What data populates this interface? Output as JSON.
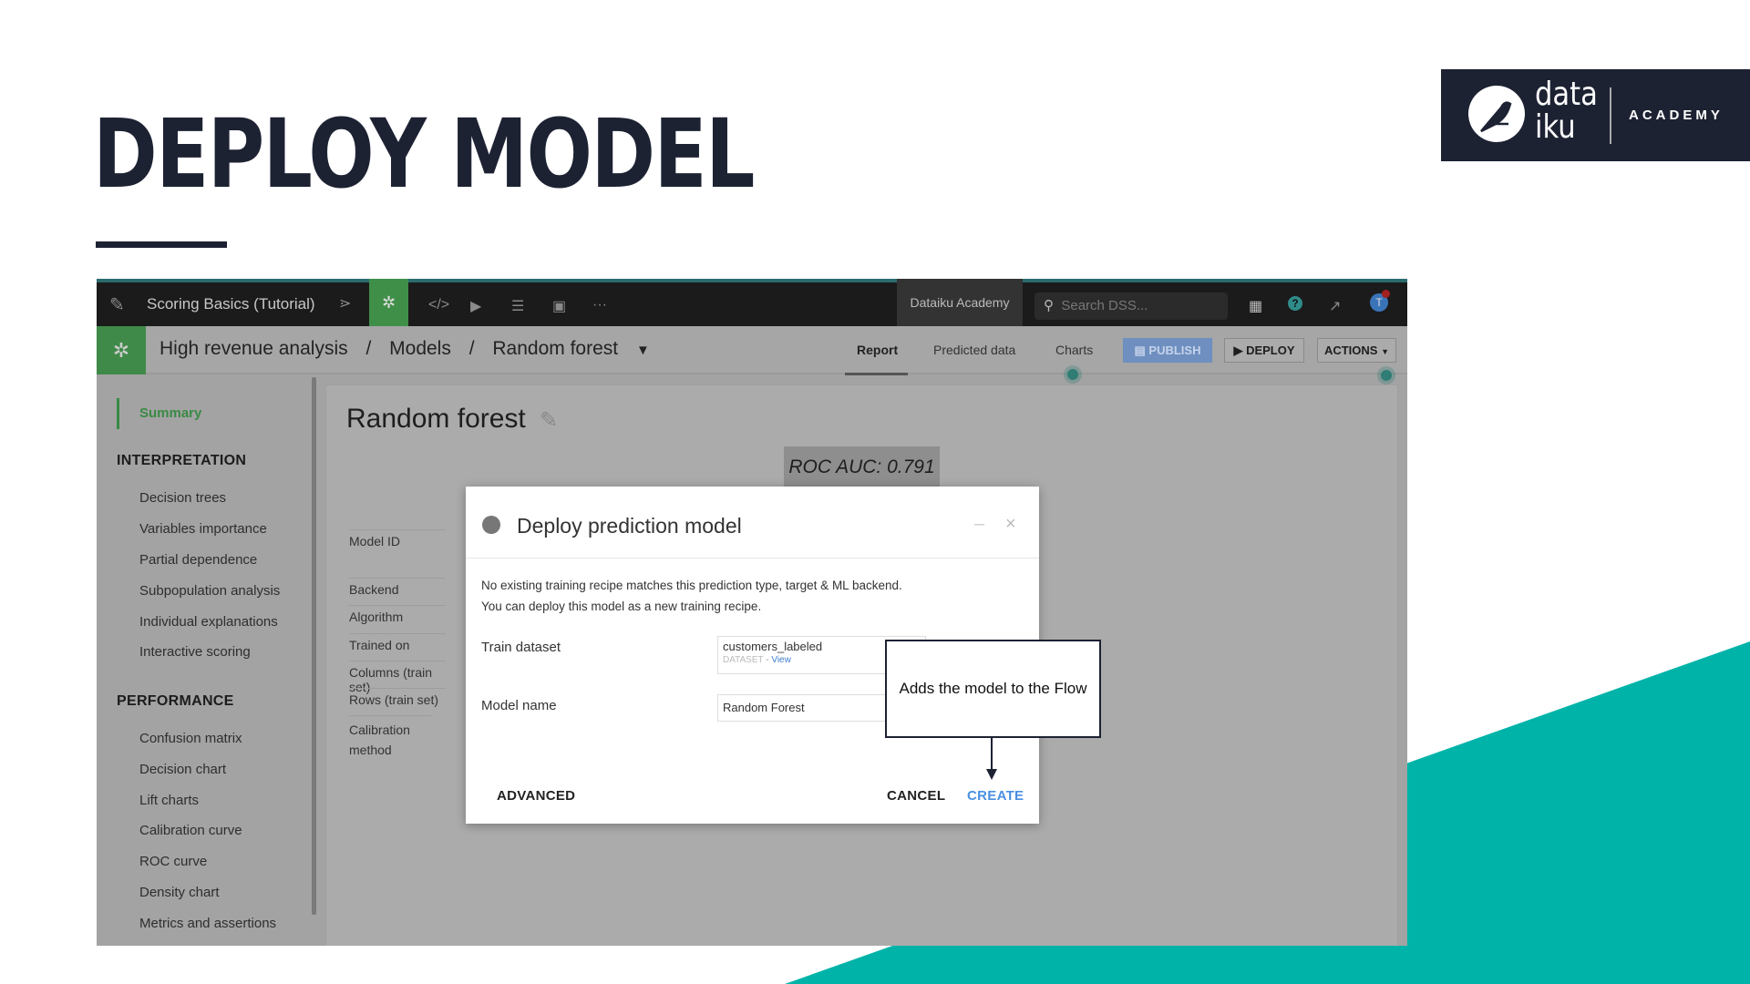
{
  "slide": {
    "title": "DEPLOY MODEL",
    "logo": {
      "word1": "data",
      "word2": "iku",
      "tagline": "ACADEMY"
    },
    "accent": "#00b3a8",
    "dark": "#1d2233"
  },
  "topbar": {
    "project": "Scoring Basics (Tutorial)",
    "instance": "Dataiku Academy",
    "search_placeholder": "Search DSS...",
    "avatar": "T",
    "icons": [
      "dataiku-bird-icon",
      "flow-icon",
      "ml-icon",
      "code-icon",
      "run-icon",
      "deploy-stack-icon",
      "dashboard-icon",
      "more-icon",
      "apps-grid-icon",
      "help-icon",
      "trend-icon",
      "avatar-icon"
    ]
  },
  "breadcrumb": {
    "items": [
      "High revenue analysis",
      "Models",
      "Random forest"
    ],
    "sep": "/"
  },
  "tabs": [
    {
      "label": "Report",
      "active": true
    },
    {
      "label": "Predicted data"
    },
    {
      "label": "Charts"
    }
  ],
  "actions": {
    "publish": "PUBLISH",
    "deploy": "DEPLOY",
    "actions": "ACTIONS"
  },
  "sidebar": {
    "summary": "Summary",
    "sections": [
      {
        "title": "INTERPRETATION",
        "items": [
          "Decision trees",
          "Variables importance",
          "Partial dependence",
          "Subpopulation analysis",
          "Individual explanations",
          "Interactive scoring"
        ]
      },
      {
        "title": "PERFORMANCE",
        "items": [
          "Confusion matrix",
          "Decision chart",
          "Lift charts",
          "Calibration curve",
          "ROC curve",
          "Density chart",
          "Metrics and assertions"
        ]
      }
    ]
  },
  "main": {
    "title": "Random forest",
    "roc": "ROC AUC: 0.791",
    "labels": [
      "Model ID",
      "Backend",
      "Algorithm",
      "Trained on",
      "Columns (train set)",
      "Rows (train set)",
      "Calibration method"
    ]
  },
  "dialog": {
    "title": "Deploy prediction model",
    "line1": "No existing training recipe matches this prediction type, target & ML backend.",
    "line2": "You can deploy this model as a new training recipe.",
    "train_label": "Train dataset",
    "train_value": "customers_labeled",
    "train_type": "DATASET",
    "train_sep": " - ",
    "train_link": "View",
    "name_label": "Model name",
    "name_value": "Random Forest",
    "advanced": "ADVANCED",
    "cancel": "CANCEL",
    "create": "CREATE"
  },
  "callout": {
    "text": "Adds the model to the Flow"
  }
}
